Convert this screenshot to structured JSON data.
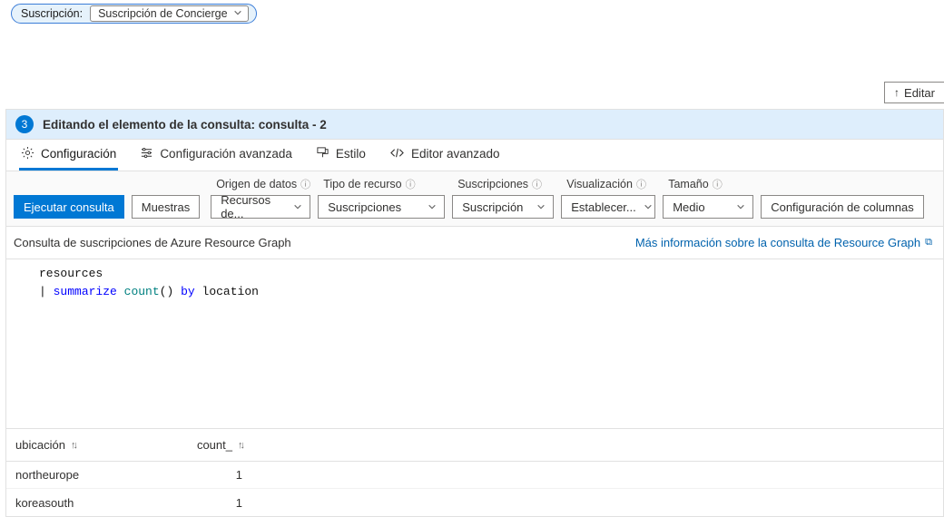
{
  "top": {
    "subscription_label": "Suscripción:",
    "subscription_value": "Suscripción de Concierge",
    "edit_label": "Editar"
  },
  "banner": {
    "step": "3",
    "title": "Editando el elemento de la consulta: consulta - 2"
  },
  "tabs": {
    "configuracion": "Configuración",
    "avanzada": "Configuración avanzada",
    "estilo": "Estilo",
    "editor": "Editor avanzado"
  },
  "controls": {
    "run_label": "Ejecutar consulta",
    "samples_label": "Muestras",
    "datasource": {
      "label": "Origen de datos",
      "value": "Recursos de..."
    },
    "restype": {
      "label": "Tipo de recurso",
      "value": "Suscripciones"
    },
    "subs": {
      "label": "Suscripciones",
      "value": "Suscripción"
    },
    "viz": {
      "label": "Visualización",
      "value": "Establecer..."
    },
    "size": {
      "label": "Tamaño",
      "value": "Medio"
    },
    "columns_label": "Configuración de columnas"
  },
  "query": {
    "description": "Consulta de suscripciones de Azure Resource Graph",
    "more_link": "Más información sobre la consulta de Resource Graph",
    "code": {
      "line1": "resources",
      "pipe": "|",
      "summarize": "summarize",
      "count": "count",
      "parens": "()",
      "by": "by",
      "location": "location"
    }
  },
  "results": {
    "headers": {
      "location": "ubicación",
      "count": "count_"
    },
    "rows": [
      {
        "location": "northeurope",
        "count": "1"
      },
      {
        "location": "koreasouth",
        "count": "1"
      }
    ]
  }
}
